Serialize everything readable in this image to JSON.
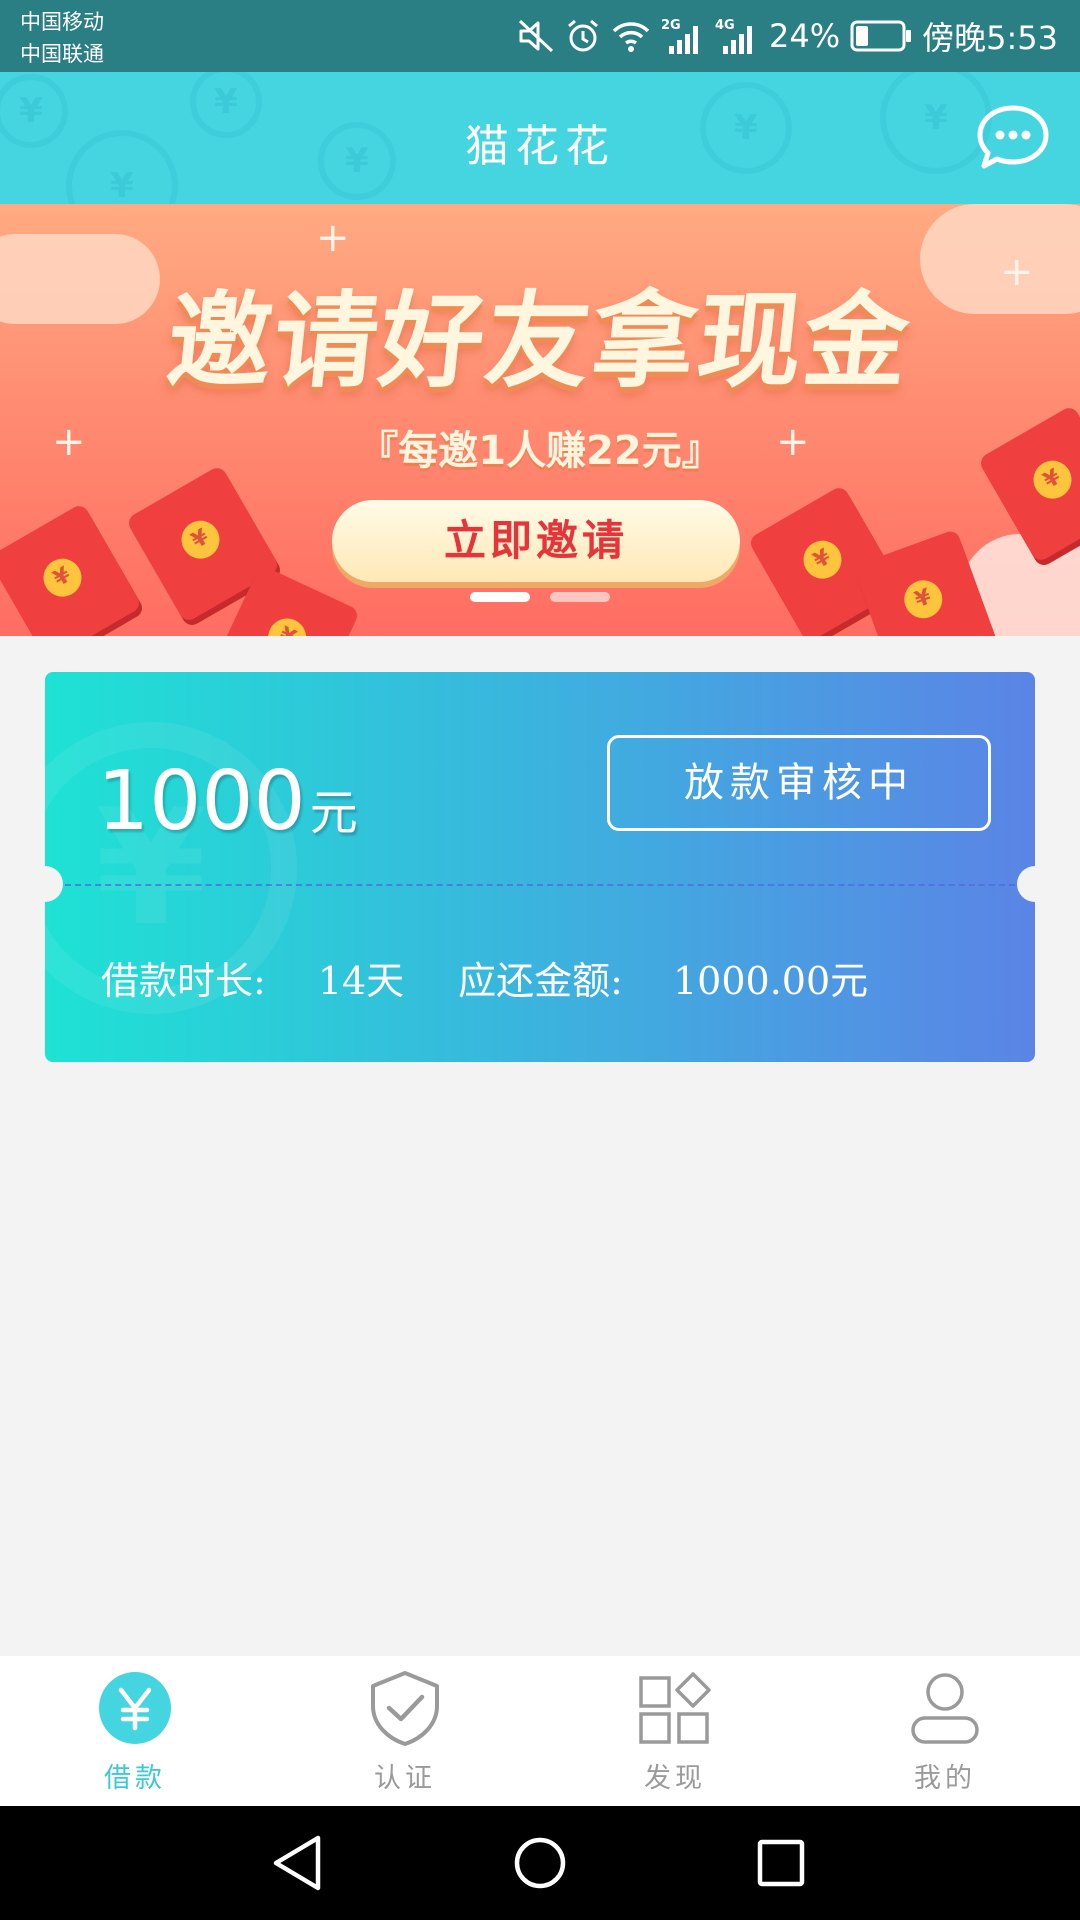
{
  "status_bar": {
    "carrier_1": "中国移动",
    "carrier_2": "中国联通",
    "net_2g": "2G",
    "net_4g": "4G",
    "battery": "24%",
    "time": "傍晚5:53",
    "icons": [
      "mute-icon",
      "alarm-icon",
      "wifi-icon",
      "signal-2g-icon",
      "signal-4g-icon",
      "battery-icon"
    ]
  },
  "header": {
    "title": "猫花花",
    "message_icon": "chat-bubble-icon"
  },
  "banner": {
    "headline": "邀请好友拿现金",
    "subline": "『每邀1人赚22元』",
    "button_label": "立即邀请",
    "dots": [
      {
        "active": true
      },
      {
        "active": false
      }
    ]
  },
  "loan_card": {
    "amount": "1000",
    "amount_unit": "元",
    "status_label": "放款审核中",
    "duration_label": "借款时长:",
    "duration_value": "14天",
    "repay_label": "应还金额:",
    "repay_value": "1000.00元"
  },
  "tabs": [
    {
      "label": "借款",
      "icon": "yuan-icon",
      "active": true
    },
    {
      "label": "认证",
      "icon": "shield-check-icon",
      "active": false
    },
    {
      "label": "发现",
      "icon": "grid-icon",
      "active": false
    },
    {
      "label": "我的",
      "icon": "user-icon",
      "active": false
    }
  ],
  "colors": {
    "accent": "#45d5e0",
    "status_bar": "#2a7f84",
    "card_start": "#1ee2d4",
    "card_end": "#5b84e6",
    "banner_button_text": "#e5353a",
    "tab_active": "#3fc9d6",
    "tab_inactive": "#9a9a9a"
  }
}
